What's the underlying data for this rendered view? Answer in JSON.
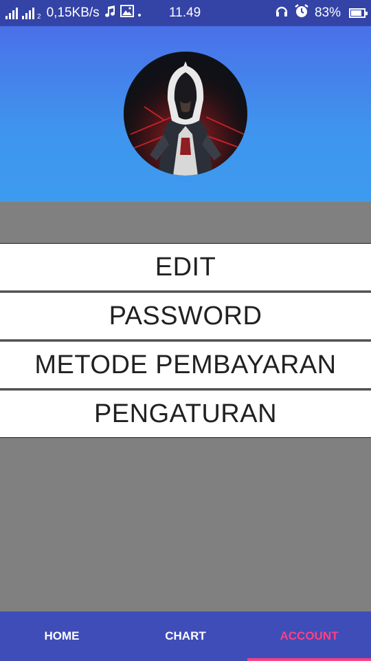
{
  "status_bar": {
    "sim2_label": "2",
    "net_speed": "0,15KB/s",
    "time": "11.49",
    "battery": "83%",
    "battery_level": 0.83,
    "icons": [
      "signal-icon",
      "signal-h-icon",
      "music-note-icon",
      "image-icon",
      "headset-icon",
      "alarm-icon",
      "battery-icon"
    ]
  },
  "profile": {
    "avatar_icon": "hooded-assassin-avatar"
  },
  "menu": {
    "items": [
      {
        "label": "EDIT"
      },
      {
        "label": "PASSWORD"
      },
      {
        "label": "METODE PEMBAYARAN"
      },
      {
        "label": "PENGATURAN"
      }
    ]
  },
  "bottom_nav": {
    "tabs": [
      {
        "label": "HOME",
        "active": false
      },
      {
        "label": "CHART",
        "active": false
      },
      {
        "label": "ACCOUNT",
        "active": true
      }
    ],
    "active_color": "#ff4081"
  },
  "colors": {
    "status_bar_bg": "#3443a6",
    "header_gradient_top": "#4a70e8",
    "header_gradient_bottom": "#3d9bee",
    "page_bg": "#808080",
    "nav_bg": "#3f4db8"
  }
}
